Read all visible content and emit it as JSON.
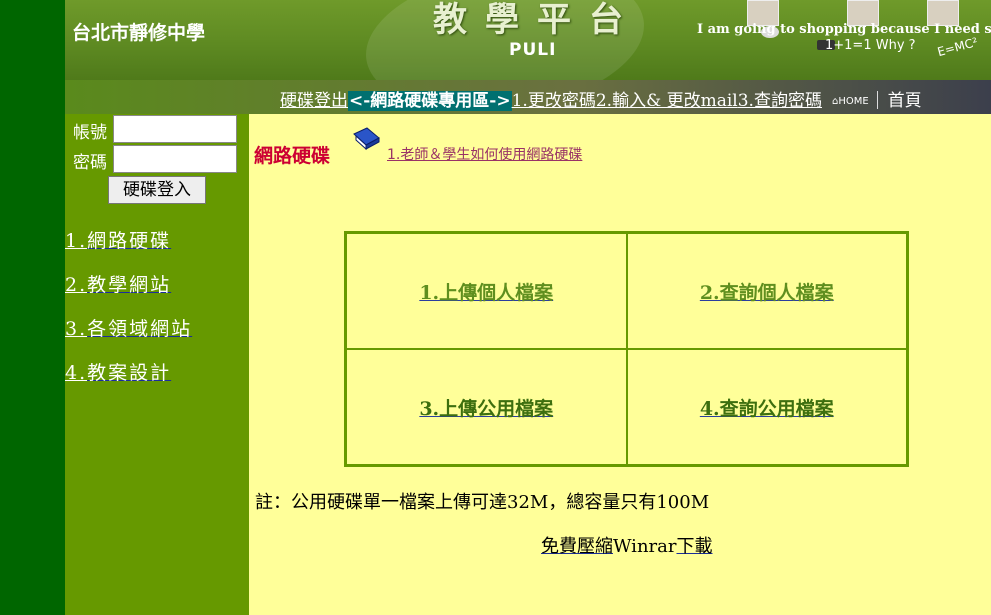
{
  "banner": {
    "school_name": "台北市靜修中學",
    "platform_title": "教學平台",
    "platform_sub": "PULI",
    "slogan": "I am going to shopping because I need some fu",
    "math_text": "1+1=1  Why ?",
    "formula": "E=MC²"
  },
  "nav": {
    "logout": "硬碟登出",
    "highlight": "<-網路硬碟專用區->",
    "item1": "1.更改密碼",
    "item2": "2.輸入& 更改mail",
    "item3": "3.查詢密碼",
    "home_label": "HOME",
    "homepage": "首頁"
  },
  "login": {
    "account_label": "帳號",
    "password_label": "密碼",
    "account_value": "",
    "password_value": "",
    "button": "硬碟登入"
  },
  "sidebar": {
    "items": [
      {
        "num": "1.",
        "text": "網路硬碟"
      },
      {
        "num": "2.",
        "text": "教學網站"
      },
      {
        "num": "3.",
        "text": "各領域網站"
      },
      {
        "num": "4.",
        "text": "教案設計"
      }
    ]
  },
  "main": {
    "title": "網路硬碟",
    "howto": "1.老師＆學生如何使用網路硬碟",
    "cells": [
      {
        "text": "1.上傳個人檔案"
      },
      {
        "text": "2.查詢個人檔案"
      },
      {
        "text": "3.上傳公用檔案"
      },
      {
        "text": "4.查詢公用檔案"
      }
    ],
    "note": "註：公用硬碟單一檔案上傳可達32M，總容量只有100M",
    "winrar_link1": "免費壓縮",
    "winrar_text": "Winrar",
    "winrar_link2": "下載"
  },
  "colors": {
    "page_bg": "#ffff99",
    "sidebar_bg": "#669900",
    "left_strip": "#006600",
    "title_red": "#cc0033",
    "highlight_bg": "#007070"
  }
}
